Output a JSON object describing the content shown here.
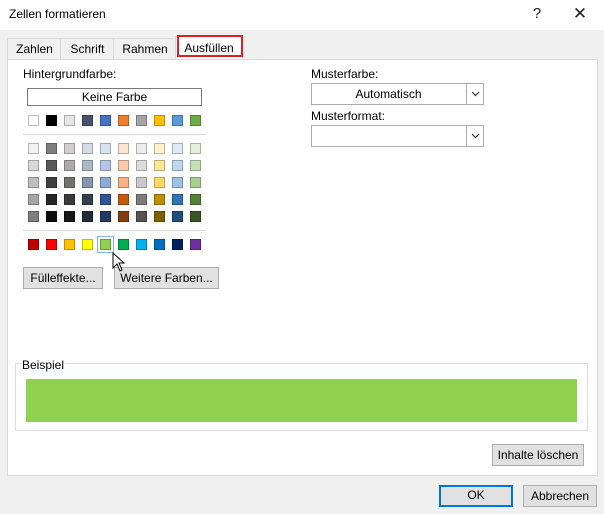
{
  "window": {
    "title": "Zellen formatieren",
    "help": "?",
    "close": "✕"
  },
  "tabs": [
    {
      "label": "Zahlen"
    },
    {
      "label": "Schrift"
    },
    {
      "label": "Rahmen"
    },
    {
      "label": "Ausfüllen"
    }
  ],
  "fill": {
    "background_label": "Hintergrundfarbe:",
    "no_color": "Keine Farbe",
    "fill_effects": "Fülleffekte...",
    "more_colors": "Weitere Farben...",
    "selected_color": "#92d050",
    "theme_row": [
      "#ffffff",
      "#000000",
      "#e7e6e6",
      "#44546a",
      "#4472c4",
      "#ed7d31",
      "#a5a5a5",
      "#ffc000",
      "#5b9bd5",
      "#70ad47"
    ],
    "tint_rows": [
      [
        "#f2f2f2",
        "#7f7f7f",
        "#d0cece",
        "#d6dce4",
        "#d9e2f3",
        "#fbe5d5",
        "#ededed",
        "#fff2cc",
        "#deebf6",
        "#e2efd9"
      ],
      [
        "#d8d8d8",
        "#595959",
        "#aeaaaa",
        "#adb9ca",
        "#b4c6e7",
        "#f7cbac",
        "#dbdbdb",
        "#fee599",
        "#bdd7ee",
        "#c5e0b3"
      ],
      [
        "#bfbfbf",
        "#3f3f3f",
        "#757070",
        "#8496b0",
        "#8eaadb",
        "#f4b183",
        "#c9c9c9",
        "#ffd965",
        "#9cc3e5",
        "#a8d08d"
      ],
      [
        "#a5a5a5",
        "#262626",
        "#3a3838",
        "#323f4f",
        "#2f5496",
        "#c55a11",
        "#7b7b7b",
        "#bf8f00",
        "#2e75b5",
        "#538135"
      ],
      [
        "#7f7f7f",
        "#0c0c0c",
        "#171616",
        "#222a35",
        "#1f3864",
        "#833c0b",
        "#525252",
        "#7f6000",
        "#1e4e79",
        "#375623"
      ]
    ],
    "standard_row": [
      "#c00000",
      "#ff0000",
      "#ffc000",
      "#ffff00",
      "#92d050",
      "#00b050",
      "#00b0f0",
      "#0070c0",
      "#002060",
      "#7030a0"
    ]
  },
  "pattern": {
    "color_label": "Musterfarbe:",
    "color_value": "Automatisch",
    "style_label": "Musterformat:",
    "style_value": ""
  },
  "sample": {
    "label": "Beispiel"
  },
  "buttons": {
    "clear": "Inhalte löschen",
    "ok": "OK",
    "cancel": "Abbrechen"
  }
}
